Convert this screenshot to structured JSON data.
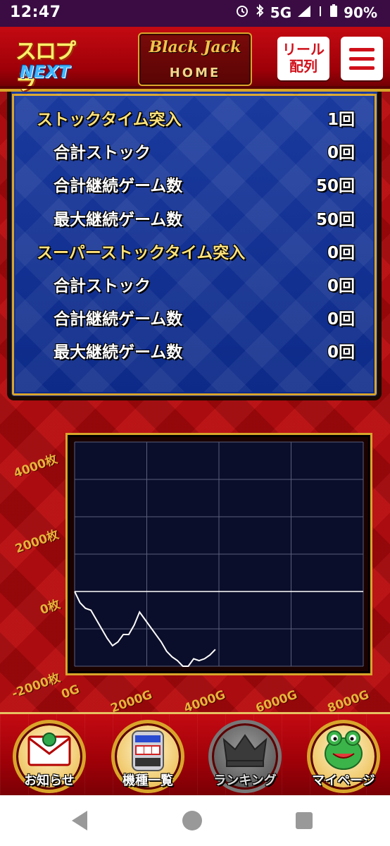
{
  "status_bar": {
    "time": "12:47",
    "network": "5G",
    "battery": "90%",
    "icons": [
      "alarm-icon",
      "bluetooth-icon",
      "signal-icon",
      "battery-icon"
    ]
  },
  "header": {
    "logo_top": "スロプラ",
    "logo_bottom": "NEXT",
    "home_brand": "Black Jack",
    "home_label": "HOME",
    "reel_label_1": "リール",
    "reel_label_2": "配列",
    "menu_icon": "hamburger-menu-icon"
  },
  "stats": [
    {
      "label": "ストックタイム突入",
      "value": "1回",
      "level": "main"
    },
    {
      "label": "合計ストック",
      "value": "0回",
      "level": "sub"
    },
    {
      "label": "合計継続ゲーム数",
      "value": "50回",
      "level": "sub"
    },
    {
      "label": "最大継続ゲーム数",
      "value": "50回",
      "level": "sub"
    },
    {
      "label": "スーパーストックタイム突入",
      "value": "0回",
      "level": "main"
    },
    {
      "label": "合計ストック",
      "value": "0回",
      "level": "sub"
    },
    {
      "label": "合計継続ゲーム数",
      "value": "0回",
      "level": "sub"
    },
    {
      "label": "最大継続ゲーム数",
      "value": "0回",
      "level": "sub"
    }
  ],
  "chart_data": {
    "type": "line",
    "title": "",
    "xlabel": "",
    "ylabel": "",
    "x_ticks": [
      "0G",
      "2000G",
      "4000G",
      "6000G",
      "8000G"
    ],
    "y_ticks": [
      "4000枚",
      "2000枚",
      "0枚",
      "-2000枚"
    ],
    "xlim": [
      0,
      8000
    ],
    "ylim": [
      -2000,
      4000
    ],
    "grid": true,
    "background_color": "#0b0e2a",
    "line_color": "#ffffff",
    "series": [
      {
        "x": [
          0,
          150,
          300,
          450,
          600,
          750,
          900,
          1050,
          1200,
          1350,
          1500,
          1650,
          1800,
          1950,
          2100,
          2250,
          2400,
          2550,
          2700,
          2850,
          3000,
          3150,
          3300,
          3450,
          3600,
          3750,
          3900
        ],
        "y": [
          0,
          -300,
          -450,
          -500,
          -750,
          -1000,
          -1250,
          -1450,
          -1350,
          -1150,
          -1150,
          -900,
          -550,
          -750,
          -950,
          -1150,
          -1350,
          -1600,
          -1750,
          -1850,
          -2000,
          -2000,
          -1800,
          -1850,
          -1800,
          -1700,
          -1550
        ]
      }
    ]
  },
  "bottom_nav": [
    {
      "label": "お知らせ",
      "icon": "envelope-icon",
      "enabled": true
    },
    {
      "label": "機種一覧",
      "icon": "slot-machine-icon",
      "enabled": true
    },
    {
      "label": "ランキング",
      "icon": "crown-icon",
      "enabled": false
    },
    {
      "label": "マイページ",
      "icon": "frog-icon",
      "enabled": true
    }
  ],
  "system_nav": {
    "back_icon": "back-icon",
    "home_icon": "home-circle-icon",
    "recents_icon": "recents-icon"
  }
}
